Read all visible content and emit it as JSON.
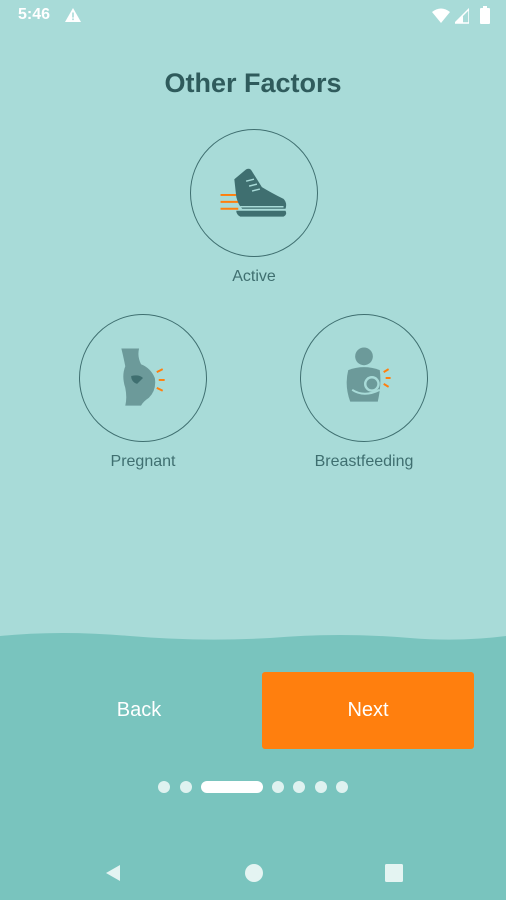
{
  "status_bar": {
    "time": "5:46",
    "icons": [
      "warning-icon",
      "wifi-icon",
      "signal-icon",
      "battery-icon"
    ]
  },
  "page": {
    "title": "Other Factors"
  },
  "factors": [
    {
      "label": "Active",
      "icon": "sneaker-icon"
    },
    {
      "label": "Pregnant",
      "icon": "pregnant-icon"
    },
    {
      "label": "Breastfeeding",
      "icon": "breastfeeding-icon"
    }
  ],
  "buttons": {
    "back_label": "Back",
    "next_label": "Next"
  },
  "pagination": {
    "total": 7,
    "current": 3
  },
  "nav_bar": {
    "icons": [
      "nav-back-icon",
      "nav-home-icon",
      "nav-recents-icon"
    ]
  },
  "colors": {
    "background": "#a8dbd8",
    "bottom": "#79c4be",
    "accent": "#ff7f0e",
    "icon_dark": "#3f6f70",
    "title": "#2f5b5c"
  }
}
